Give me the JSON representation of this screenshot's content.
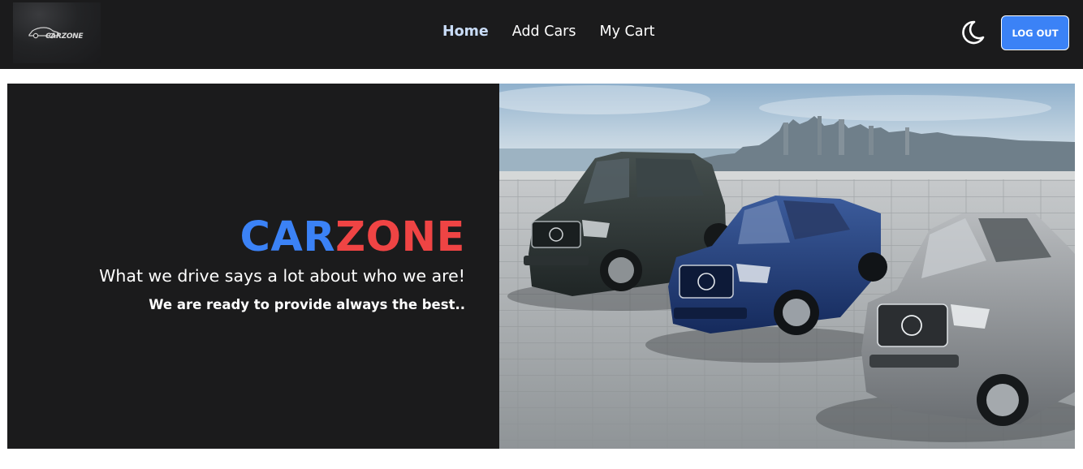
{
  "navbar": {
    "logo": {
      "text": "CARZONE",
      "icon": "car-logo-icon"
    },
    "links": [
      {
        "label": "Home",
        "active": true
      },
      {
        "label": "Add Cars",
        "active": false
      },
      {
        "label": "My Cart",
        "active": false
      }
    ],
    "theme_toggle_icon": "moon-icon",
    "logout_label": "LOG OUT"
  },
  "hero": {
    "brand_part1": "CAR",
    "brand_part2": "ZONE",
    "tagline": "What we drive says a lot about who we are!",
    "subline": "We are ready to provide always the best..",
    "image_icon": "cars-showcase-image"
  },
  "colors": {
    "nav_bg": "#1b1b1c",
    "accent_blue": "#3b82f6",
    "accent_red": "#ef4444",
    "active_link": "#c9dcf7"
  }
}
